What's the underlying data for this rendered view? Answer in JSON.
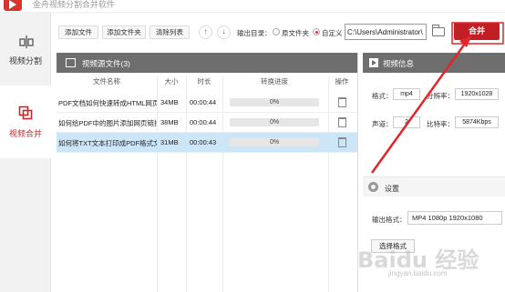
{
  "window": {
    "title": "金舟视频分割合并软件"
  },
  "sidebar": {
    "items": [
      {
        "label": "视频分割",
        "active": false
      },
      {
        "label": "视频合并",
        "active": true
      }
    ]
  },
  "toolbar": {
    "add_file": "添加文件",
    "add_folder": "添加文件夹",
    "clear_list": "清除列表",
    "up_glyph": "↑",
    "down_glyph": "↓",
    "output_dir_label": "输出目录：",
    "radio_original": "原文件夹",
    "radio_custom": "自定义",
    "output_path": "C:\\Users\\Administrator\\",
    "merge_label": "合并"
  },
  "file_panel": {
    "title": "视频源文件(3)",
    "columns": [
      "文件名称",
      "大小",
      "时长",
      "转换进度",
      "操作"
    ],
    "rows": [
      {
        "name": "PDF文档如何快速转成HTML网页格式",
        "size": "34MB",
        "duration": "00:00:44",
        "progress": "0%"
      },
      {
        "name": "如何给PDF中的图片添加网页链接",
        "size": "38MB",
        "duration": "00:00:44",
        "progress": "0%"
      },
      {
        "name": "如何将TXT文本打印成PDF格式文件",
        "size": "31MB",
        "duration": "00:00:43",
        "progress": "0%"
      }
    ]
  },
  "info_panel": {
    "title": "视频信息",
    "format_label": "格式：",
    "format_value": "mp4",
    "resolution_label": "分辨率：",
    "resolution_value": "1920x1028",
    "channel_label": "声道：",
    "channel_value": "2",
    "bitrate_label": "比特率：",
    "bitrate_value": "5874Kbps"
  },
  "settings_panel": {
    "title": "设置",
    "output_format_label": "输出格式：",
    "output_format_value": "MP4 1080p 1920x1080",
    "choose_format_label": "选择格式"
  },
  "watermark": {
    "main": "Baidu 经验",
    "sub": "jingyan.baidu.com"
  },
  "colors": {
    "accent": "#c21f25",
    "panel_header": "#6e6e6e",
    "selected_row": "#cde6f7"
  }
}
